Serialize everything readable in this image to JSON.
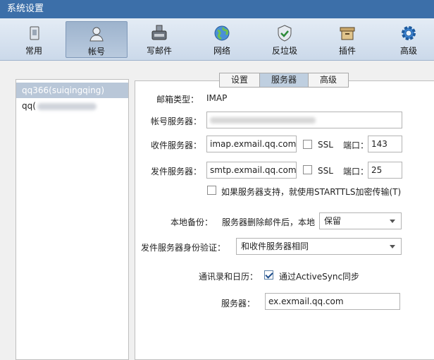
{
  "window": {
    "title": "系统设置"
  },
  "toolbar": {
    "items": [
      {
        "label": "常用",
        "icon": "general-icon"
      },
      {
        "label": "帐号",
        "icon": "user-icon",
        "active": true
      },
      {
        "label": "写邮件",
        "icon": "compose-icon"
      },
      {
        "label": "网络",
        "icon": "globe-icon"
      },
      {
        "label": "反垃圾",
        "icon": "shield-icon"
      },
      {
        "label": "插件",
        "icon": "plugin-icon"
      },
      {
        "label": "高级",
        "icon": "gear-icon"
      }
    ]
  },
  "accounts": {
    "items": [
      {
        "label": "qq366(suiqingqing)",
        "selected": true
      },
      {
        "label": "qq(",
        "selected": false
      }
    ]
  },
  "tabs": [
    {
      "label": "设置"
    },
    {
      "label": "服务器",
      "active": true
    },
    {
      "label": "高级"
    }
  ],
  "form": {
    "mail_type_label": "邮箱类型：",
    "mail_type_value": "IMAP",
    "account_server_label": "帐号服务器：",
    "incoming_label": "收件服务器：",
    "incoming_value": "imap.exmail.qq.com",
    "ssl_label": "SSL",
    "port_label": "端口：",
    "incoming_port": "143",
    "outgoing_label": "发件服务器：",
    "outgoing_value": "smtp.exmail.qq.com",
    "outgoing_port": "25",
    "starttls_label": "如果服务器支持，就使用STARTTLS加密传输(T)",
    "backup_label": "本地备份：",
    "backup_text": "服务器删除邮件后，本地",
    "backup_option": "保留",
    "auth_label": "发件服务器身份验证：",
    "auth_option": "和收件服务器相同",
    "contacts_label": "通讯录和日历：",
    "activesync_label": "通过ActiveSync同步",
    "activesync_checked": true,
    "server_label": "服务器：",
    "server_value": "ex.exmail.qq.com"
  }
}
